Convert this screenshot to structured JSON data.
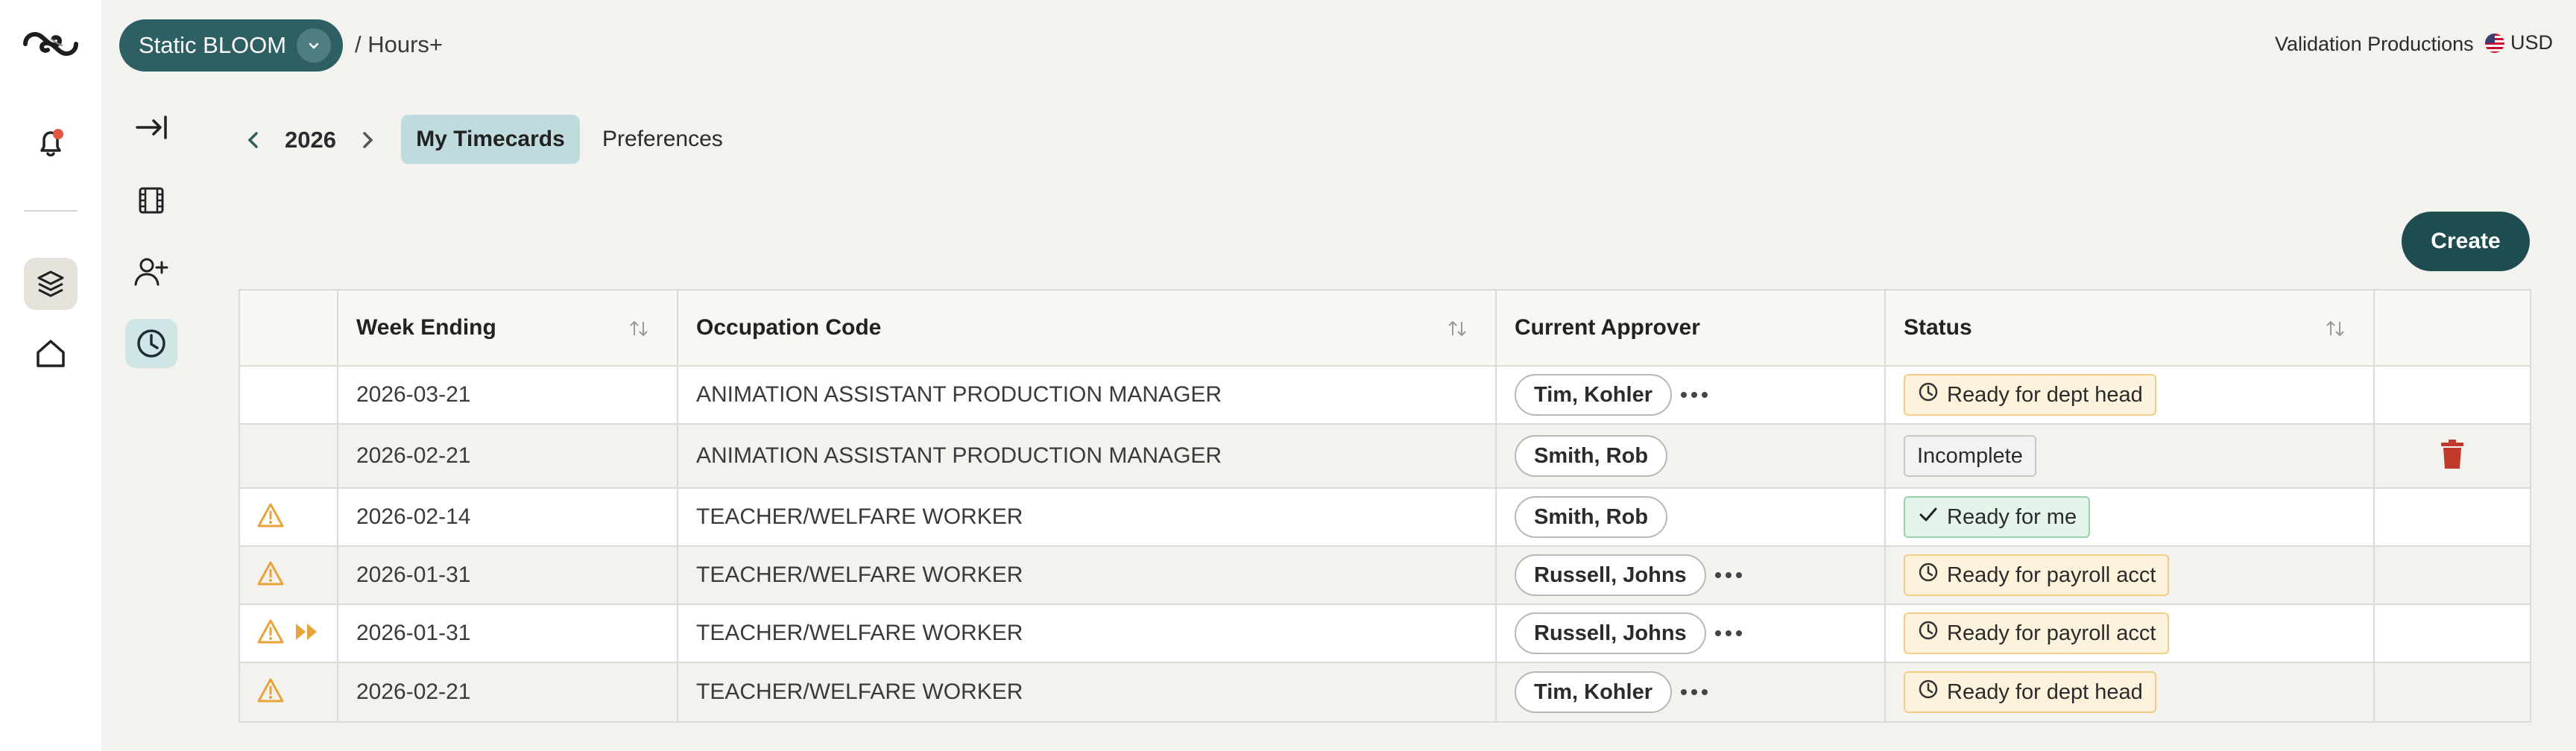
{
  "header": {
    "org_name": "Static BLOOM",
    "breadcrumb": "/ Hours+",
    "company": "Validation Productions",
    "currency": "USD"
  },
  "icons": {
    "logo": "brand-logo-icon",
    "notification": "bell-icon",
    "layers": "layers-icon",
    "home": "home-icon",
    "collapse": "collapse-arrow-icon",
    "film": "film-icon",
    "add_user": "add-user-icon",
    "clock": "clock-icon"
  },
  "colors": {
    "accent": "#2e5f63",
    "create": "#1f4d4f",
    "tab_active": "#bfdbdd",
    "warning": "#e8a33a",
    "delete": "#c0392b"
  },
  "year_nav": {
    "year": "2026"
  },
  "tabs": [
    {
      "label": "My Timecards",
      "active": true
    },
    {
      "label": "Preferences",
      "active": false
    }
  ],
  "create_label": "Create",
  "table": {
    "columns": [
      "Week Ending",
      "Occupation Code",
      "Current Approver",
      "Status"
    ],
    "rows": [
      {
        "warn": false,
        "forward": false,
        "week": "2026-03-21",
        "occupation": "ANIMATION ASSISTANT PRODUCTION MANAGER",
        "approver": "Tim, Kohler",
        "more": true,
        "status": "Ready for dept head",
        "status_kind": "clock",
        "delete": false
      },
      {
        "warn": false,
        "forward": false,
        "week": "2026-02-21",
        "occupation": "ANIMATION ASSISTANT PRODUCTION MANAGER",
        "approver": "Smith, Rob",
        "more": false,
        "status": "Incomplete",
        "status_kind": "none",
        "delete": true
      },
      {
        "warn": true,
        "forward": false,
        "week": "2026-02-14",
        "occupation": "TEACHER/WELFARE WORKER",
        "approver": "Smith, Rob",
        "more": false,
        "status": "Ready for me",
        "status_kind": "check",
        "delete": false
      },
      {
        "warn": true,
        "forward": false,
        "week": "2026-01-31",
        "occupation": "TEACHER/WELFARE WORKER",
        "approver": "Russell, Johns",
        "more": true,
        "status": "Ready for payroll acct",
        "status_kind": "clock",
        "delete": false
      },
      {
        "warn": true,
        "forward": true,
        "week": "2026-01-31",
        "occupation": "TEACHER/WELFARE WORKER",
        "approver": "Russell, Johns",
        "more": true,
        "status": "Ready for payroll acct",
        "status_kind": "clock",
        "delete": false
      },
      {
        "warn": true,
        "forward": false,
        "week": "2026-02-21",
        "occupation": "TEACHER/WELFARE WORKER",
        "approver": "Tim, Kohler",
        "more": true,
        "status": "Ready for dept head",
        "status_kind": "clock",
        "delete": false
      }
    ]
  }
}
